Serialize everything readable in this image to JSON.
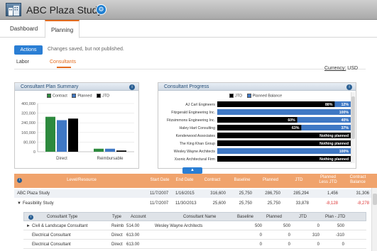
{
  "app": {
    "title": "ABC Plaza Study"
  },
  "tabs": [
    "Dashboard",
    "Planning"
  ],
  "toolbar": {
    "actions_label": "Actions",
    "publish_note": "Changes saved, but not published."
  },
  "subtabs": {
    "labor": "Labor",
    "consultants": "Consultants"
  },
  "currency": {
    "label": "Currency:",
    "value": "USD"
  },
  "summary": {
    "title": "Consultant Plan Summary",
    "legend": [
      "Contract",
      "Planned",
      "JTD"
    ]
  },
  "progress": {
    "title": "Consultant Progress",
    "legend": [
      "JTD",
      "Planned Balance"
    ]
  },
  "chart_data": [
    {
      "type": "bar",
      "categories": [
        "Direct",
        "Reimbursable"
      ],
      "series": [
        {
          "name": "Contract",
          "values": [
            290000,
            25000
          ]
        },
        {
          "name": "Planned",
          "values": [
            262000,
            25000
          ]
        },
        {
          "name": "JTD",
          "values": [
            275000,
            10000
          ]
        }
      ],
      "ylim": [
        0,
        400000
      ],
      "yticks": [
        "0",
        "80,000",
        "160,000",
        "240,000",
        "320,000",
        "400,000"
      ],
      "colors": [
        "#2d8a3e",
        "#3f78c4",
        "#000000"
      ],
      "legend_position": "top"
    },
    {
      "type": "bar",
      "orientation": "horizontal",
      "categories": [
        "AJ Carl Engineers",
        "Fitzgerald Engineering Inc.",
        "Fitzsimmons Engineering Inc.",
        "Haley Hart Consulting",
        "Kenderwood Associates",
        "The King Khan Group",
        "Wesley Wayne Architects",
        "Xsonic Architectural Firm"
      ],
      "series": [
        {
          "name": "JTD",
          "values": [
            88,
            0,
            60,
            63,
            0,
            0,
            0,
            0
          ]
        },
        {
          "name": "Planned Balance",
          "values": [
            12,
            100,
            40,
            37,
            0,
            0,
            100,
            0
          ]
        }
      ],
      "labels": [
        [
          "88%",
          "12%"
        ],
        [
          "",
          "100%"
        ],
        [
          "60%",
          "40%"
        ],
        [
          "63%",
          "37%"
        ],
        [
          "",
          "Nothing planned"
        ],
        [
          "",
          "Nothing planned"
        ],
        [
          "",
          "100%"
        ],
        [
          "",
          "Nothing planned"
        ]
      ],
      "colors": [
        "#000000",
        "#3f78c4"
      ],
      "legend_position": "top"
    }
  ],
  "table": {
    "headers": [
      "Level/Resource",
      "Start Date",
      "End Date",
      "Contract",
      "Baseline",
      "Planned",
      "JTD",
      "Planned Less JTD",
      "Contract Balance"
    ],
    "rows": [
      {
        "name": "ABC Plaza Study",
        "start": "11/7/2007",
        "end": "1/16/2015",
        "contract": "316,600",
        "baseline": "25,750",
        "planned": "286,750",
        "jtd": "285,294",
        "pljtd": "1,456",
        "balance": "31,306"
      },
      {
        "name": "Feasibility Study",
        "start": "11/7/2007",
        "end": "11/30/2013",
        "contract": "25,600",
        "baseline": "25,750",
        "planned": "25,750",
        "jtd": "33,878",
        "pljtd": "-8,128",
        "balance": "-8,278"
      }
    ]
  },
  "subtable": {
    "headers": [
      "Consultant Type",
      "Type",
      "Account",
      "Consultant Name",
      "Baseline",
      "Planned",
      "JTD",
      "Plan - JTD"
    ],
    "rows": [
      {
        "ctype": "Civil & Landscape Consultant",
        "type": "Reimb",
        "account": "514.00",
        "name": "Wesley Wayne Architects",
        "baseline": "500",
        "planned": "500",
        "jtd": "0",
        "pjtd": "500"
      },
      {
        "ctype": "Electrical Consultant",
        "type": "Direct",
        "account": "613.00",
        "name": "",
        "baseline": "0",
        "planned": "0",
        "jtd": "310",
        "pjtd": "-310"
      },
      {
        "ctype": "Electrical Consultant",
        "type": "Direct",
        "account": "613.00",
        "name": "",
        "baseline": "0",
        "planned": "0",
        "jtd": "0",
        "pjtd": "0"
      }
    ]
  }
}
